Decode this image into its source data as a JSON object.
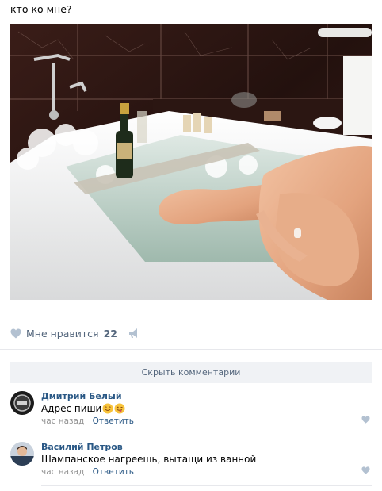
{
  "post": {
    "text": "кто ко мне?",
    "image_alt": "photo-bath"
  },
  "actions": {
    "like_label": "Мне нравится",
    "like_count": "22"
  },
  "comments_toggle": "Скрыть комментарии",
  "comments": [
    {
      "author": "Дмитрий Белый",
      "text": "Адрес пиши",
      "emoji": [
        "smiling-face-emoji",
        "winking-tongue-emoji"
      ],
      "time": "час назад",
      "reply": "Ответить"
    },
    {
      "author": "Василий Петров",
      "text": "Шампанское нагреешь, вытащи из ванной",
      "time": "час назад",
      "reply": "Ответить"
    }
  ],
  "colors": {
    "link": "#2a5885",
    "muted": "#55677d",
    "meta": "#939393",
    "divider": "#e7e8ec",
    "button_bg": "#f0f2f5"
  }
}
